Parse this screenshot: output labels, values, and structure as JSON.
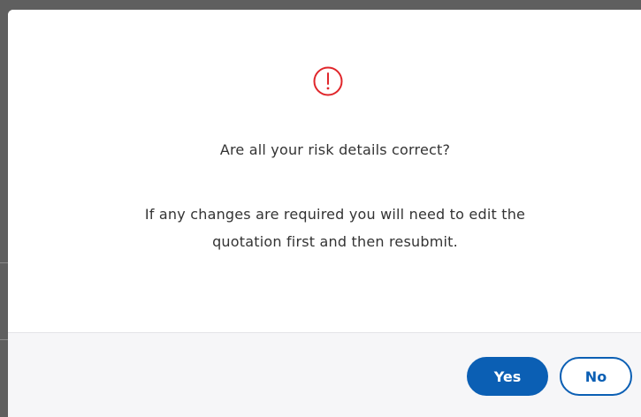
{
  "dialog": {
    "icon": "exclamation-circle-icon",
    "icon_color": "#e0262b",
    "question": "Are all your risk details correct?",
    "detail_line1": "If any changes are required you will need to edit the",
    "detail_line2": "quotation first and then resubmit.",
    "yes_label": "Yes",
    "no_label": "No",
    "accent_color": "#0b5fb4"
  }
}
